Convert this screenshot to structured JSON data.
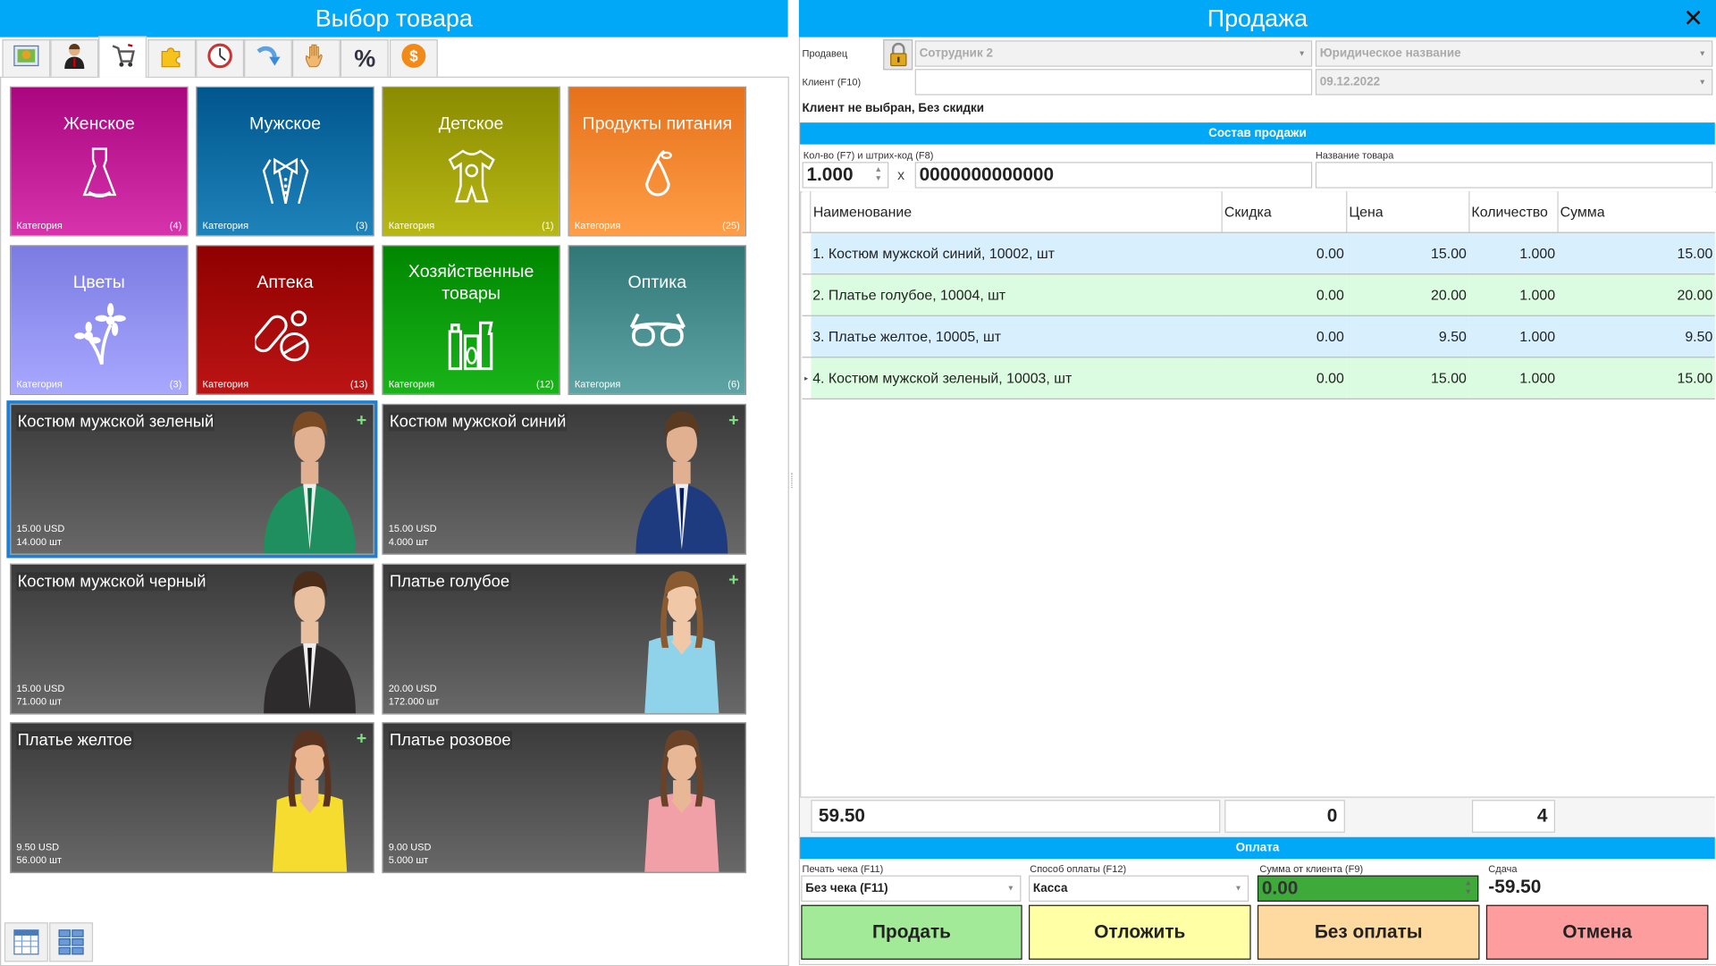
{
  "left": {
    "title": "Выбор товара",
    "toolbar": [
      {
        "icon": "picture-icon"
      },
      {
        "icon": "user-icon"
      },
      {
        "icon": "cart-icon",
        "active": true
      },
      {
        "icon": "puzzle-icon"
      },
      {
        "icon": "clock-icon"
      },
      {
        "icon": "redo-arrow-icon"
      },
      {
        "icon": "hand-icon"
      },
      {
        "icon": "percent-icon",
        "glyph": "%"
      },
      {
        "icon": "dollar-coin-icon",
        "glyph": "$"
      }
    ],
    "categories": [
      {
        "name": "Женское",
        "label": "Категория",
        "count": "(4)",
        "color": "#c21f98",
        "icon": "dress-icon"
      },
      {
        "name": "Мужское",
        "label": "Категория",
        "count": "(3)",
        "color": "#0a6fa6",
        "icon": "tuxedo-icon"
      },
      {
        "name": "Детское",
        "label": "Категория",
        "count": "(1)",
        "color": "#a3a400",
        "icon": "baby-bodysuit-icon"
      },
      {
        "name": "Продукты питания",
        "label": "Категория",
        "count": "(25)",
        "color": "#ff8a33",
        "icon": "pear-icon"
      },
      {
        "name": "Цветы",
        "label": "Категория",
        "count": "(3)",
        "color": "#9494fb",
        "icon": "flowers-icon"
      },
      {
        "name": "Аптека",
        "label": "Категория",
        "count": "(13)",
        "color": "#a80000",
        "icon": "pills-icon"
      },
      {
        "name": "Хозяйственные товары",
        "label": "Категория",
        "count": "(12)",
        "color": "#05a005",
        "icon": "detergent-icon"
      },
      {
        "name": "Оптика",
        "label": "Категория",
        "count": "(6)",
        "color": "#4a9090",
        "icon": "glasses-icon"
      }
    ],
    "products": [
      {
        "name": "Костюм мужской зеленый",
        "price": "15.00 USD",
        "qty": "14.000 шт",
        "plus": "+",
        "selected": true,
        "cloth": "#1f8f5f",
        "skin": "#e0b090",
        "hair": "#7a4a25"
      },
      {
        "name": "Костюм мужской синий",
        "price": "15.00 USD",
        "qty": "4.000 шт",
        "plus": "+",
        "cloth": "#1f3b80",
        "skin": "#e0b090",
        "hair": "#5a3a20"
      },
      {
        "name": "Костюм мужской черный",
        "price": "15.00 USD",
        "qty": "71.000 шт",
        "cloth": "#2d2b2c",
        "skin": "#e8c0a0",
        "hair": "#4a2c18"
      },
      {
        "name": "Платье голубое",
        "price": "20.00 USD",
        "qty": "172.000 шт",
        "plus": "+",
        "cloth": "#8fd3ea",
        "skin": "#f0c8a8",
        "hair": "#8a5a30"
      },
      {
        "name": "Платье желтое",
        "price": "9.50 USD",
        "qty": "56.000 шт",
        "plus": "+",
        "cloth": "#f5dc2e",
        "skin": "#eab48f",
        "hair": "#5a3320"
      },
      {
        "name": "Платье розовое",
        "price": "9.00 USD",
        "qty": "5.000 шт",
        "cloth": "#f2a0a8",
        "skin": "#e8b896",
        "hair": "#6a4228"
      }
    ],
    "view_buttons": [
      {
        "icon": "table-view-icon"
      },
      {
        "icon": "tile-view-icon"
      }
    ]
  },
  "right": {
    "title": "Продажа",
    "close": "✕",
    "seller_label": "Продавец",
    "seller_value": "Сотрудник 2",
    "legal_name": "Юридическое название",
    "client_label": "Клиент (F10)",
    "client_value": "",
    "date": "09.12.2022",
    "status": "Клиент не выбран, Без скидки",
    "section_sale": "Состав продажи",
    "qty_label": "Кол-во (F7) и штрих-код (F8)",
    "qty_value": "1.000",
    "times": "x",
    "barcode": "0000000000000",
    "product_name_label": "Название товара",
    "product_name_value": "",
    "columns": [
      "Наименование",
      "Скидка",
      "Цена",
      "Количество",
      "Сумма"
    ],
    "rows": [
      {
        "name": "1. Костюм мужской синий, 10002, шт",
        "discount": "0.00",
        "price": "15.00",
        "qty": "1.000",
        "sum": "15.00"
      },
      {
        "name": "2. Платье голубое, 10004, шт",
        "discount": "0.00",
        "price": "20.00",
        "qty": "1.000",
        "sum": "20.00"
      },
      {
        "name": "3. Платье желтое, 10005, шт",
        "discount": "0.00",
        "price": "9.50",
        "qty": "1.000",
        "sum": "9.50"
      },
      {
        "name": "4. Костюм мужской зеленый, 10003, шт",
        "discount": "0.00",
        "price": "15.00",
        "qty": "1.000",
        "sum": "15.00"
      }
    ],
    "totals": {
      "sum": "59.50",
      "discount": "0",
      "count": "4"
    },
    "section_payment": "Оплата",
    "receipt_label": "Печать чека (F11)",
    "receipt_value": "Без чека (F11)",
    "method_label": "Способ оплаты (F12)",
    "method_value": "Касса",
    "client_sum_label": "Сумма от клиента (F9)",
    "client_sum_value": "0.00",
    "change_label": "Сдача",
    "change_value": "-59.50",
    "buttons": {
      "sell": "Продать",
      "postpone": "Отложить",
      "no_payment": "Без оплаты",
      "cancel": "Отмена"
    }
  }
}
